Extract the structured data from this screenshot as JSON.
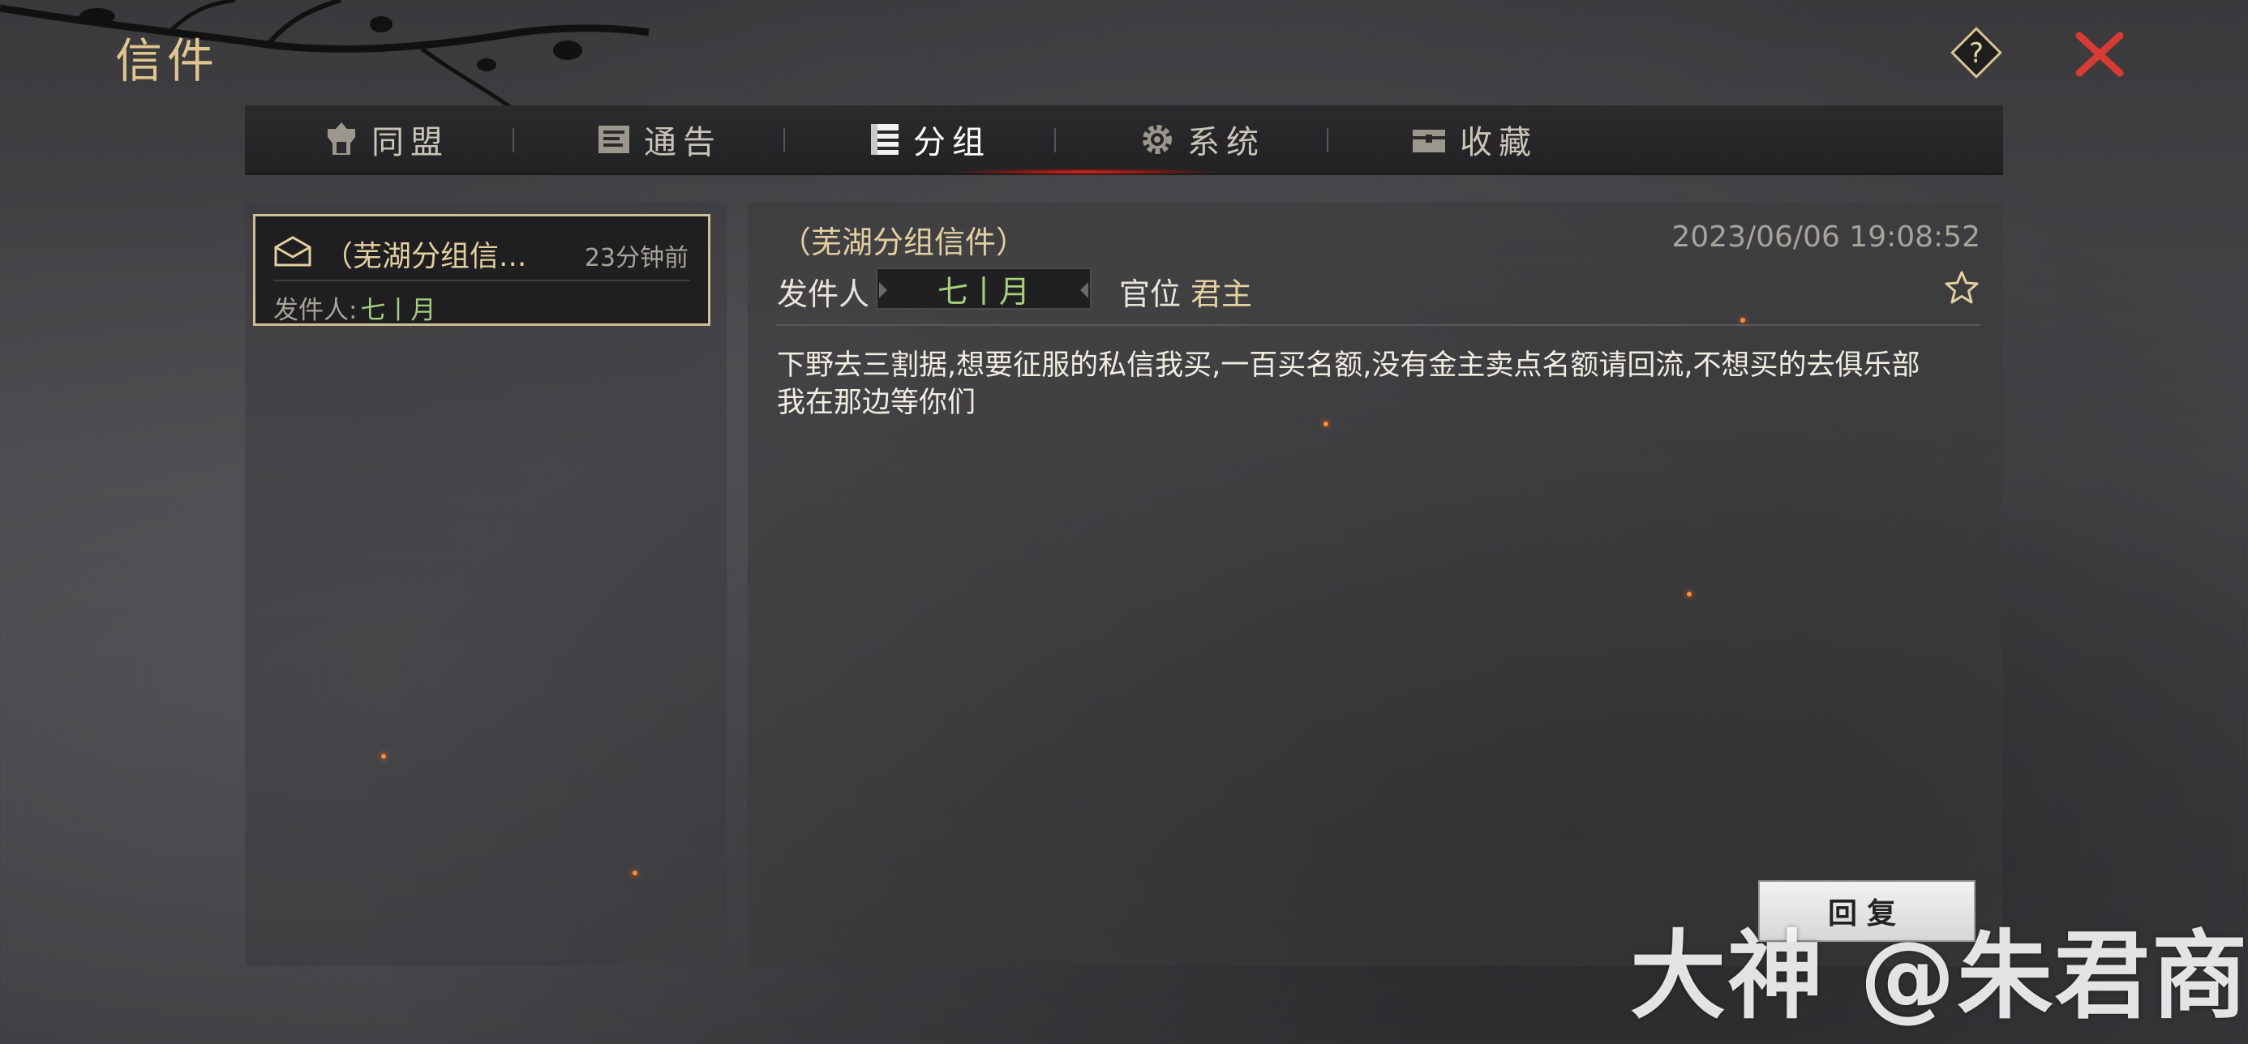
{
  "window": {
    "title": "信件"
  },
  "tabs": [
    {
      "label": "同盟",
      "icon": "alliance-icon"
    },
    {
      "label": "通告",
      "icon": "announcement-icon"
    },
    {
      "label": "分组",
      "icon": "group-icon",
      "active": true
    },
    {
      "label": "系统",
      "icon": "gear-icon"
    },
    {
      "label": "收藏",
      "icon": "chest-icon"
    }
  ],
  "mail_list": [
    {
      "title": "（芜湖分组信...",
      "time": "23分钟前",
      "sender_label": "发件人:",
      "sender": "七丨月",
      "icon": "envelope-icon"
    }
  ],
  "detail": {
    "title": "（芜湖分组信件）",
    "date": "2023/06/06 19:08:52",
    "sender_label": "发件人",
    "sender": "七丨月",
    "rank_label": "官位",
    "rank": "君主",
    "body": "下野去三割据,想要征服的私信我买,一百买名额,没有金主卖点名额请回流,不想买的去俱乐部我在那边等你们"
  },
  "actions": {
    "reply": "回复"
  },
  "watermark": {
    "text": "大神 @朱君商更"
  },
  "colors": {
    "gold": "#e3cf9f",
    "green": "#a6d07a",
    "close_red": "#d83a34",
    "active_glow": "#e6281e"
  }
}
